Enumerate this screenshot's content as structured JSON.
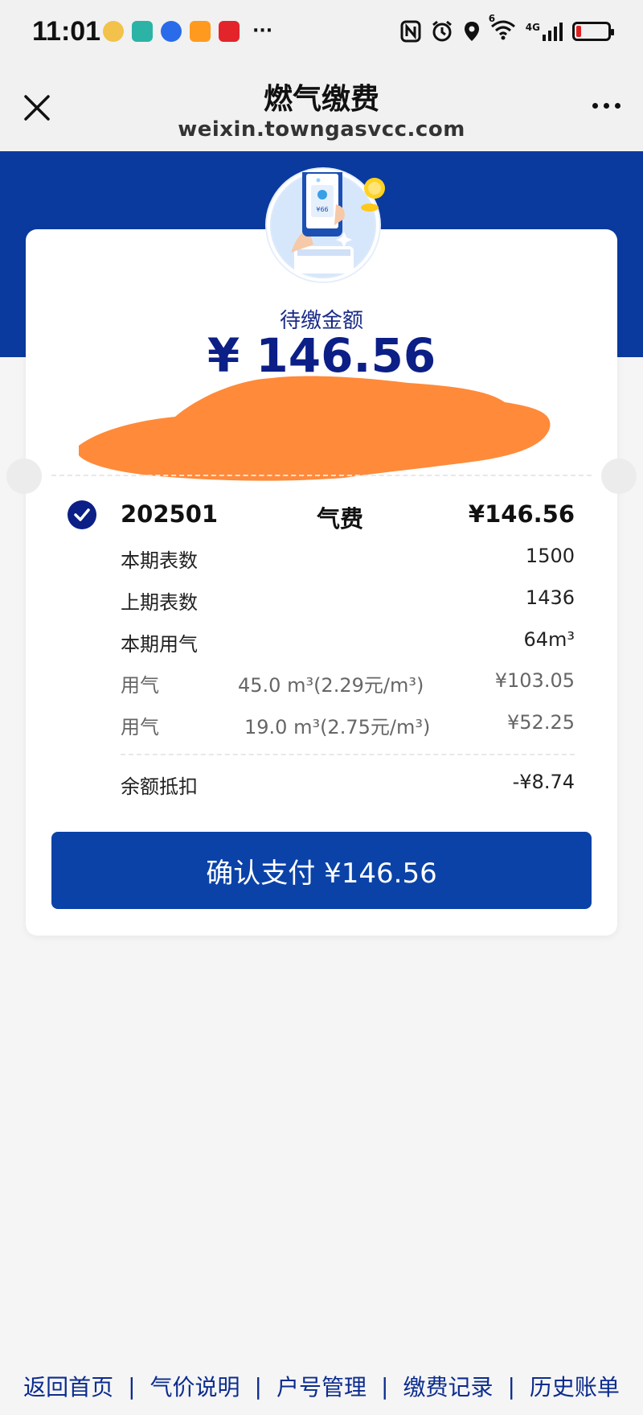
{
  "status_bar": {
    "time": "11:01",
    "network": "4G",
    "wifi_badge": "6"
  },
  "nav": {
    "title": "燃气缴费",
    "url": "weixin.towngasvcc.com"
  },
  "bill": {
    "due_label": "待缴金额",
    "due_amount": "¥ 146.56",
    "period": "202501",
    "fee_type": "气费",
    "fee_amount": "¥146.56",
    "items": [
      {
        "label": "本期表数",
        "value": "1500"
      },
      {
        "label": "上期表数",
        "value": "1436"
      },
      {
        "label": "本期用气",
        "value": "64m³"
      }
    ],
    "tiers": [
      {
        "label": "用气",
        "detail": "45.0 m³(2.29元/m³)",
        "amount": "¥103.05"
      },
      {
        "label": "用气",
        "detail": "19.0 m³(2.75元/m³)",
        "amount": "¥52.25"
      }
    ],
    "deduction_label": "余额抵扣",
    "deduction_amount": "-¥8.74"
  },
  "pay_button_label": "确认支付 ¥146.56",
  "footer_links": [
    "返回首页",
    "气价说明",
    "户号管理",
    "缴费记录",
    "历史账单"
  ],
  "colors": {
    "brand_blue": "#0a3a9e",
    "button_blue": "#0a42a8",
    "amount_navy": "#0b1f86",
    "redaction_orange": "#ff8a3a"
  }
}
